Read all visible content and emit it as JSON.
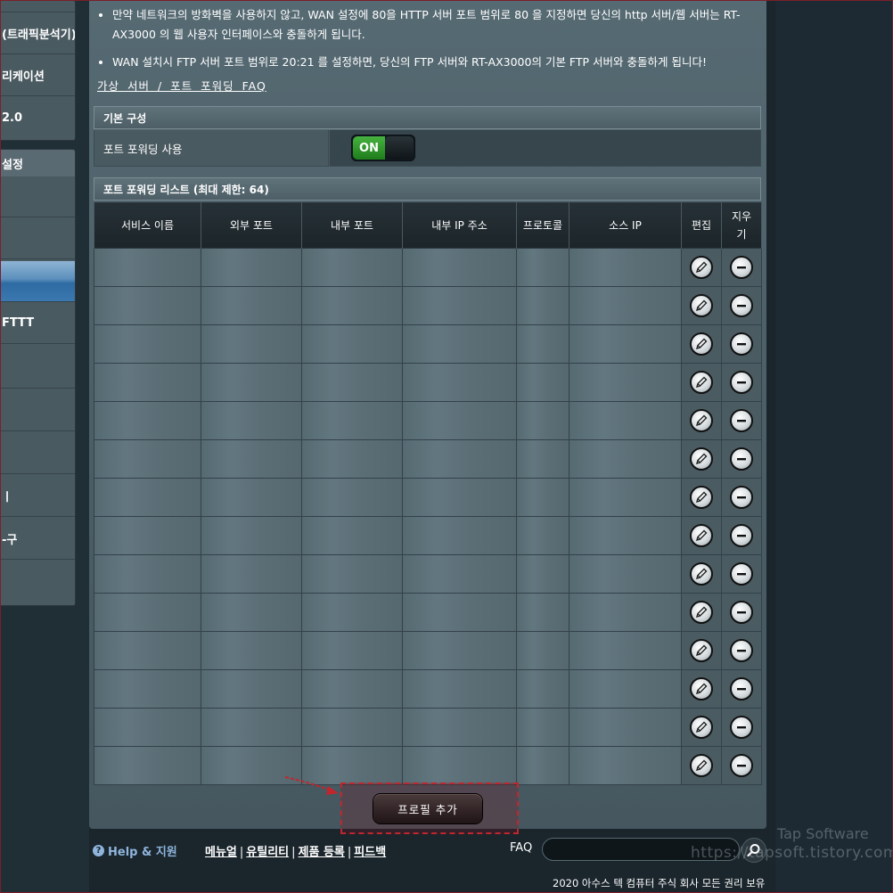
{
  "sidebar": {
    "items": [
      {
        "label": "(트래픽분석기)"
      },
      {
        "label": "리케이션"
      },
      {
        "label": "2.0"
      },
      {
        "label": "설정"
      },
      {
        "label": "FTTT"
      },
      {
        "label": "ㅣ"
      },
      {
        "label": "-구"
      }
    ]
  },
  "notes": [
    "만약 네트워크의 방화벽을 사용하지 않고, WAN 설정에 80을 HTTP 서버 포트 범위로 80 을 지정하면 당신의 http 서버/웹 서버는 RT-AX3000 의 웹 사용자 인터페이스와 충돌하게 됩니다.",
    "WAN 설치시 FTP 서버 포트 범위로 20:21 를 설정하면, 당신의 FTP 서버와 RT-AX3000의 기본 FTP 서버와 충돌하게 됩니다!"
  ],
  "faq_link": "가상 서버 / 포트 포워딩 FAQ",
  "basic_config": {
    "title": "기본 구성",
    "enable_label": "포트 포워딩 사용",
    "toggle_state": "ON"
  },
  "list": {
    "title": "포트 포워딩 리스트 (최대 제한: 64)",
    "columns": [
      "서비스 이름",
      "외부 포트",
      "내부 포트",
      "내부 IP 주소",
      "프로토콜",
      "소스 IP",
      "편집",
      "지우기"
    ],
    "row_count": 14
  },
  "add_profile": "프로필 추가",
  "footer": {
    "help": "Help & 지원",
    "links": [
      "메뉴얼",
      "유틸리티",
      "제품 등록",
      "피드백"
    ],
    "faq_label": "FAQ",
    "faq_value": "",
    "copyright": "2020 아수스 텍 컴퓨터 주식 회사 모든 권리 보유"
  },
  "watermark": {
    "line1": "Tap Software",
    "line2": "https://tapsoft.tistory.com/"
  },
  "colors": {
    "toggle_on": "#2e9a2a",
    "help_link": "#8fb5dc",
    "highlight": "#c0262e"
  }
}
